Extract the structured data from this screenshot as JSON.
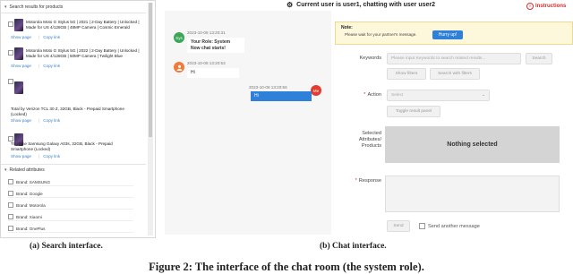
{
  "left": {
    "search_header": "Search results for products",
    "show_page": "Show page",
    "copy_link": "Copy link",
    "products": [
      {
        "title": "Motorola Moto G Stylus 5G | 2021 | 2-Day Battery | Unlocked | Made for US 4/128GB | 48MP Camera | Cosmic Emerald"
      },
      {
        "title": "Motorola Moto G Stylus 5G | 2022 | 2-Day Battery | Unlocked | Made for US 4/128GB | 50MP Camera | Twilight Blue"
      },
      {
        "title": "Total by Verizon TCL 30 Z, 32GB, Black - Prepaid Smartphone (Locked)"
      },
      {
        "title": "Tracfone Samsung Galaxy A03s, 32GB, Black - Prepaid Smartphone (Locked)"
      }
    ],
    "attributes_header": "Related attributes",
    "attributes": [
      "Brand: SAMSUNG",
      "Brand: Google",
      "Brand: Motorola",
      "Brand: Xiaomi",
      "Brand: OnePlus"
    ]
  },
  "chat": {
    "title": "Current user is user1, chatting with user user2",
    "instructions": "Instructions",
    "messages": [
      {
        "avatar": "Sys",
        "time": "2023-10-08 13:20:31",
        "line1": "Your Role: System",
        "line2": "Now chat starts!"
      },
      {
        "avatar": "",
        "time": "2023-10-08 13:20:53",
        "text": "Hi"
      },
      {
        "avatar": "Me",
        "time": "2023-10-08 13:20:56",
        "text": "Hi"
      }
    ]
  },
  "right": {
    "note_title": "Note:",
    "note_text": "Please wait for your partner's message.",
    "hurry_label": "Hurry up!",
    "keywords_label": "Keywords",
    "keywords_placeholder": "Please input Keywords to search related results...",
    "search_label": "Search",
    "show_filters_label": "Show filters",
    "search_with_filters_label": "Search with filters",
    "action_label": "Action",
    "action_placeholder": "Select",
    "toggle_result_label": "Toggle result panel",
    "selected_label_1": "Selected",
    "selected_label_2": "Attributes/",
    "selected_label_3": "Products",
    "nothing_selected": "Nothing selected",
    "response_label": "Response",
    "send_label": "Send",
    "send_another_label": "Send another message"
  },
  "captions": {
    "a": "(a) Search interface.",
    "b": "(b) Chat interface.",
    "figure": "Figure 2: The interface of the chat room (the system role)."
  },
  "colors": {
    "accent": "#2f80d8",
    "instructions": "#d23030",
    "sys_avatar": "#3aa657",
    "user_avatar": "#f07a3a",
    "me_avatar": "#e33b2f"
  }
}
